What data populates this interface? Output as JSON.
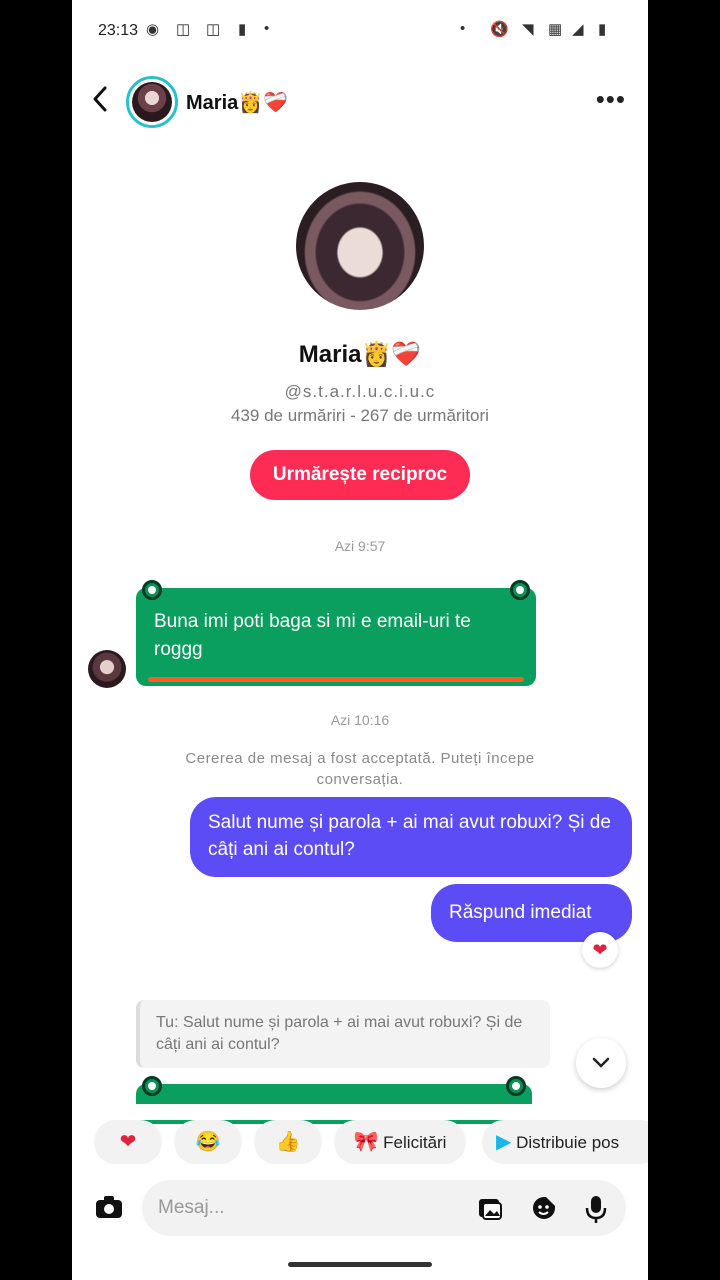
{
  "status_bar": {
    "time": "23:13",
    "left_icons": [
      "whatsapp-icon",
      "instagram-icon",
      "instagram-icon",
      "battery-saver-icon",
      "dot-icon"
    ],
    "right_icons": [
      "dot-icon",
      "mute-icon",
      "wifi-icon",
      "signal-icon",
      "battery-icon"
    ]
  },
  "header": {
    "title": "Maria👸❤️‍🩹",
    "back_glyph": "‹",
    "more_glyph": "•••"
  },
  "profile": {
    "name": "Maria👸❤️‍🩹",
    "handle": "@s.t.a.r.l.u.c.i.u.c",
    "stats": "439 de urmăriri - 267 de urmăritori",
    "follow_button": "Urmărește reciproc"
  },
  "messages": {
    "time_1": "Azi 9:57",
    "received_1": "Buna imi poti baga si mi e email-uri te roggg",
    "time_2": "Azi 10:16",
    "system_notice": "Cererea de mesaj a fost acceptată. Puteți începe conversația.",
    "sent_1": "Salut nume și parola + ai mai avut robuxi? Și de câți ani ai contul?",
    "sent_2": "Răspund imediat",
    "reply_quote": "Tu: Salut nume și parola + ai mai avut robuxi? Și de câți ani ai contul?"
  },
  "quick_replies": [
    {
      "icon": "❤",
      "label": ""
    },
    {
      "icon": "😂",
      "label": ""
    },
    {
      "icon": "👍",
      "label": ""
    },
    {
      "icon": "🎀",
      "label": "Felicitări"
    },
    {
      "icon": "▶",
      "label": "Distribuie pos"
    }
  ],
  "composer": {
    "placeholder": "Mesaj..."
  },
  "colors": {
    "accent_pink": "#fe2c55",
    "sent_bubble": "#5b4cf5",
    "received_bubble": "#0a9f5e"
  }
}
